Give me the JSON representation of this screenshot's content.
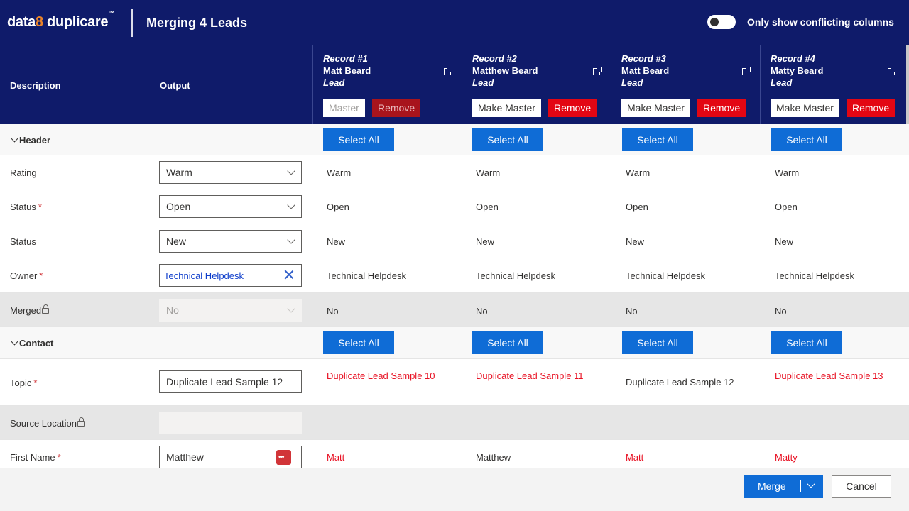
{
  "app": {
    "brand_pre": "data",
    "brand_num": "8",
    "brand_post": " duplicare",
    "brand_tm": "™",
    "title": "Merging 4 Leads"
  },
  "toggle": {
    "label": "Only show conflicting columns",
    "on": false
  },
  "columns": {
    "description": "Description",
    "output": "Output"
  },
  "records": [
    {
      "title": "Record #1",
      "name": "Matt Beard",
      "type": "Lead",
      "master_label": "Master",
      "remove_label": "Remove"
    },
    {
      "title": "Record #2",
      "name": "Matthew Beard",
      "type": "Lead",
      "master_label": "Make Master",
      "remove_label": "Remove"
    },
    {
      "title": "Record #3",
      "name": "Matt Beard",
      "type": "Lead",
      "master_label": "Make Master",
      "remove_label": "Remove"
    },
    {
      "title": "Record #4",
      "name": "Matty Beard",
      "type": "Lead",
      "master_label": "Make Master",
      "remove_label": "Remove"
    }
  ],
  "select_all_label": "Select All",
  "sections": {
    "header": "Header",
    "contact": "Contact"
  },
  "fields": {
    "rating": {
      "label": "Rating",
      "output": "Warm",
      "values": [
        "Warm",
        "Warm",
        "Warm",
        "Warm"
      ]
    },
    "status_req": {
      "label": "Status",
      "required": "*",
      "output": "Open",
      "values": [
        "Open",
        "Open",
        "Open",
        "Open"
      ]
    },
    "status": {
      "label": "Status",
      "output": "New",
      "values": [
        "New",
        "New",
        "New",
        "New"
      ]
    },
    "owner": {
      "label": "Owner",
      "required": "*",
      "output": "Technical Helpdesk",
      "values": [
        "Technical Helpdesk",
        "Technical Helpdesk",
        "Technical Helpdesk",
        "Technical Helpdesk"
      ]
    },
    "merged": {
      "label": "Merged",
      "output": "No",
      "values": [
        "No",
        "No",
        "No",
        "No"
      ]
    },
    "topic": {
      "label": "Topic",
      "required": "*",
      "output": "Duplicate Lead Sample 12",
      "values": [
        "Duplicate Lead Sample 10",
        "Duplicate Lead Sample 11",
        "Duplicate Lead Sample 12",
        "Duplicate Lead Sample 13"
      ]
    },
    "source_location": {
      "label": "Source Location"
    },
    "first_name": {
      "label": "First Name",
      "required": "*",
      "output": "Matthew",
      "values": [
        "Matt",
        "Matthew",
        "Matt",
        "Matty"
      ]
    }
  },
  "footer": {
    "merge_label": "Merge",
    "cancel_label": "Cancel"
  },
  "colors": {
    "header_bg": "#0f1b6a",
    "accent": "#0f6cd6",
    "remove": "#e30613",
    "conflict": "#e81123",
    "brand_eight": "#e8832a"
  }
}
